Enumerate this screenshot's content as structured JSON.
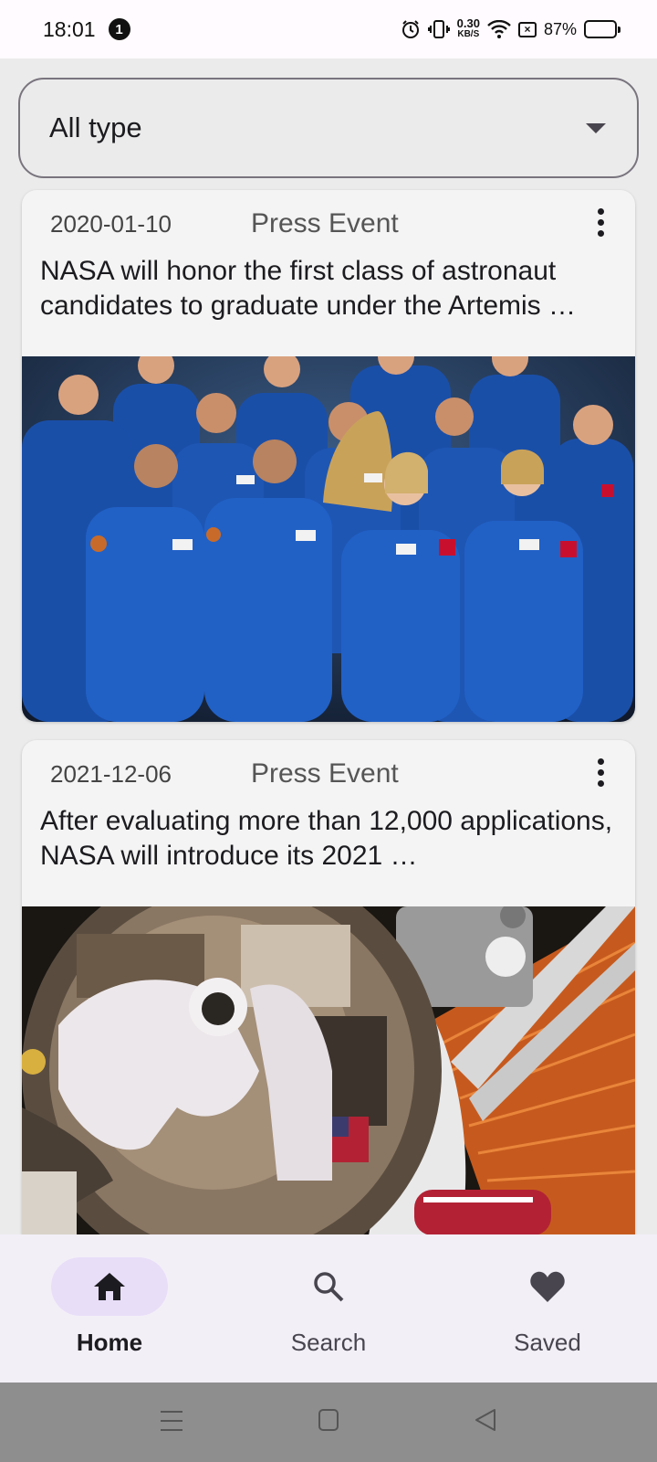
{
  "status_bar": {
    "time": "18:01",
    "notification_count": "1",
    "net_speed": "0.30",
    "net_unit": "KB/S",
    "battery": "87%",
    "battery_level": 0.87
  },
  "filter": {
    "selected": "All type"
  },
  "feed": [
    {
      "date": "2020-01-10",
      "type": "Press Event",
      "title": "NASA will honor the first class of astronaut candidates to graduate under the Artemis …"
    },
    {
      "date": "2021-12-06",
      "type": "Press Event",
      "title": "After evaluating more than 12,000 applications, NASA will introduce its 2021 …"
    }
  ],
  "nav": {
    "home": "Home",
    "search": "Search",
    "saved": "Saved",
    "active": "home"
  },
  "colors": {
    "active_pill": "#e8def8",
    "nav_bg": "#f3eff7",
    "flight_suit": "#1a4fa8"
  },
  "icons": [
    "alarm-icon",
    "vibrate-icon",
    "wifi-icon",
    "no-sim-icon",
    "battery-icon",
    "more-vert-icon",
    "home-icon",
    "search-icon",
    "heart-icon",
    "menu-icon",
    "square-icon",
    "back-icon"
  ]
}
